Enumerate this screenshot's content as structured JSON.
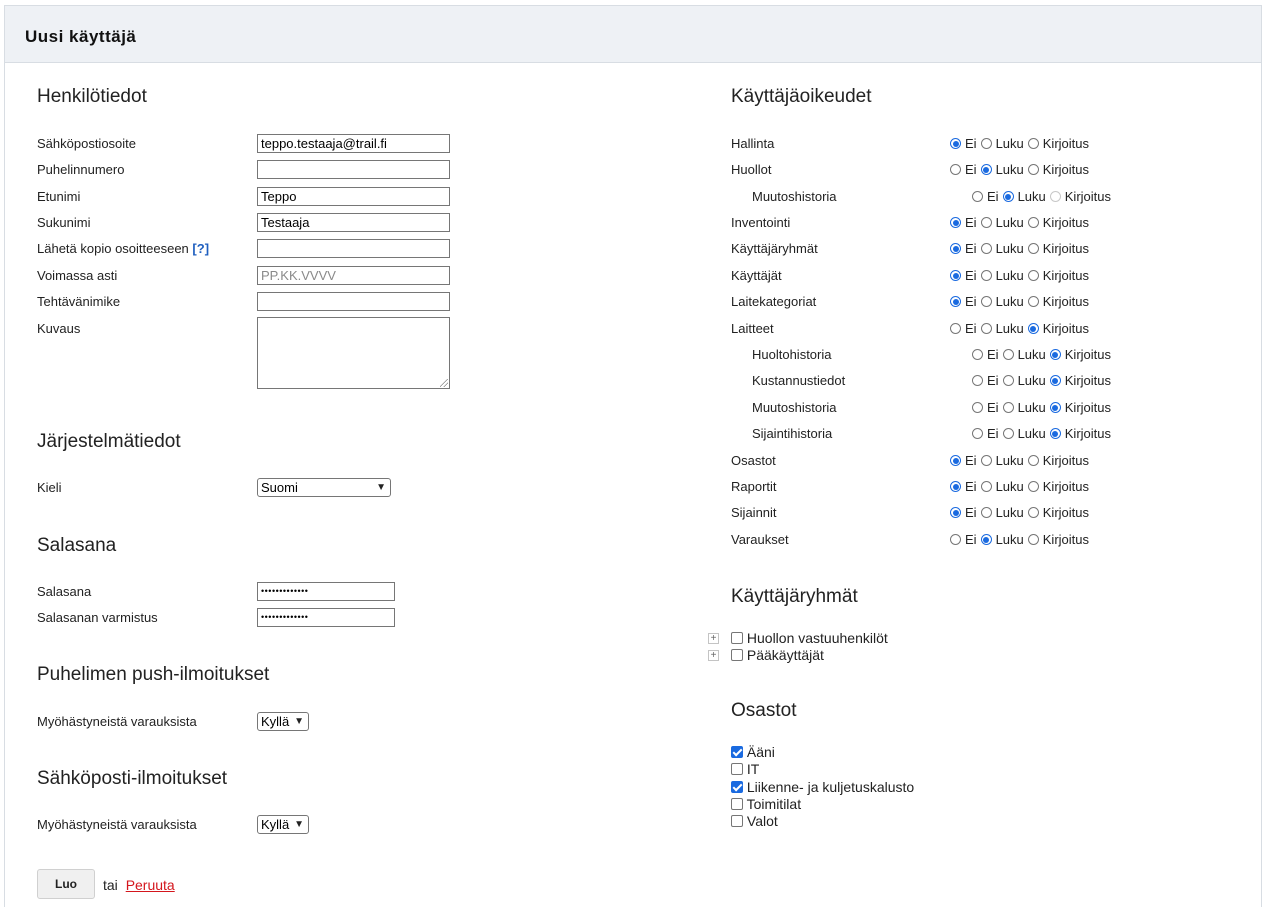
{
  "page_title": "Uusi käyttäjä",
  "personal": {
    "heading": "Henkilötiedot",
    "fields": [
      {
        "label": "Sähköpostiosoite",
        "value": "teppo.testaaja@trail.fi",
        "placeholder": ""
      },
      {
        "label": "Puhelinnumero",
        "value": "",
        "placeholder": ""
      },
      {
        "label": "Etunimi",
        "value": "Teppo",
        "placeholder": ""
      },
      {
        "label": "Sukunimi",
        "value": "Testaaja",
        "placeholder": ""
      },
      {
        "label": "Lähetä kopio osoitteeseen",
        "help": "[?]",
        "value": "",
        "placeholder": ""
      },
      {
        "label": "Voimassa asti",
        "value": "",
        "placeholder": "PP.KK.VVVV"
      },
      {
        "label": "Tehtävänimike",
        "value": "",
        "placeholder": ""
      },
      {
        "label": "Kuvaus",
        "value": "",
        "placeholder": ""
      }
    ]
  },
  "system": {
    "heading": "Järjestelmätiedot",
    "language_label": "Kieli",
    "language_value": "Suomi"
  },
  "password": {
    "heading": "Salasana",
    "password_label": "Salasana",
    "password_value": "•••••••••••••",
    "confirm_label": "Salasanan varmistus",
    "confirm_value": "•••••••••••••"
  },
  "push": {
    "heading": "Puhelimen push-ilmoitukset",
    "label": "Myöhästyneistä varauksista",
    "value": "Kyllä"
  },
  "email_notif": {
    "heading": "Sähköposti-ilmoitukset",
    "label": "Myöhästyneistä varauksista",
    "value": "Kyllä"
  },
  "actions": {
    "create_label": "Luo",
    "or_text": "tai",
    "cancel_label": "Peruuta"
  },
  "rights": {
    "heading": "Käyttäjäoikeudet",
    "option_labels": [
      "Ei",
      "Luku",
      "Kirjoitus"
    ],
    "rows": [
      {
        "label": "Hallinta",
        "sub": false,
        "selected": 0
      },
      {
        "label": "Huollot",
        "sub": false,
        "selected": 1
      },
      {
        "label": "Muutoshistoria",
        "sub": true,
        "selected": 1,
        "disabled": [
          2
        ]
      },
      {
        "label": "Inventointi",
        "sub": false,
        "selected": 0
      },
      {
        "label": "Käyttäjäryhmät",
        "sub": false,
        "selected": 0
      },
      {
        "label": "Käyttäjät",
        "sub": false,
        "selected": 0
      },
      {
        "label": "Laitekategoriat",
        "sub": false,
        "selected": 0
      },
      {
        "label": "Laitteet",
        "sub": false,
        "selected": 2
      },
      {
        "label": "Huoltohistoria",
        "sub": true,
        "selected": 2
      },
      {
        "label": "Kustannustiedot",
        "sub": true,
        "selected": 2
      },
      {
        "label": "Muutoshistoria",
        "sub": true,
        "selected": 2
      },
      {
        "label": "Sijaintihistoria",
        "sub": true,
        "selected": 2
      },
      {
        "label": "Osastot",
        "sub": false,
        "selected": 0
      },
      {
        "label": "Raportit",
        "sub": false,
        "selected": 0
      },
      {
        "label": "Sijainnit",
        "sub": false,
        "selected": 0
      },
      {
        "label": "Varaukset",
        "sub": false,
        "selected": 1
      }
    ]
  },
  "groups": {
    "heading": "Käyttäjäryhmät",
    "expand_symbol": "+",
    "items": [
      {
        "label": "Huollon vastuuhenkilöt",
        "checked": false
      },
      {
        "label": "Pääkäyttäjät",
        "checked": false
      }
    ]
  },
  "departments": {
    "heading": "Osastot",
    "items": [
      {
        "label": "Ääni",
        "checked": true
      },
      {
        "label": "IT",
        "checked": false
      },
      {
        "label": "Liikenne- ja kuljetuskalusto",
        "checked": true
      },
      {
        "label": "Toimitilat",
        "checked": false
      },
      {
        "label": "Valot",
        "checked": false
      }
    ]
  }
}
